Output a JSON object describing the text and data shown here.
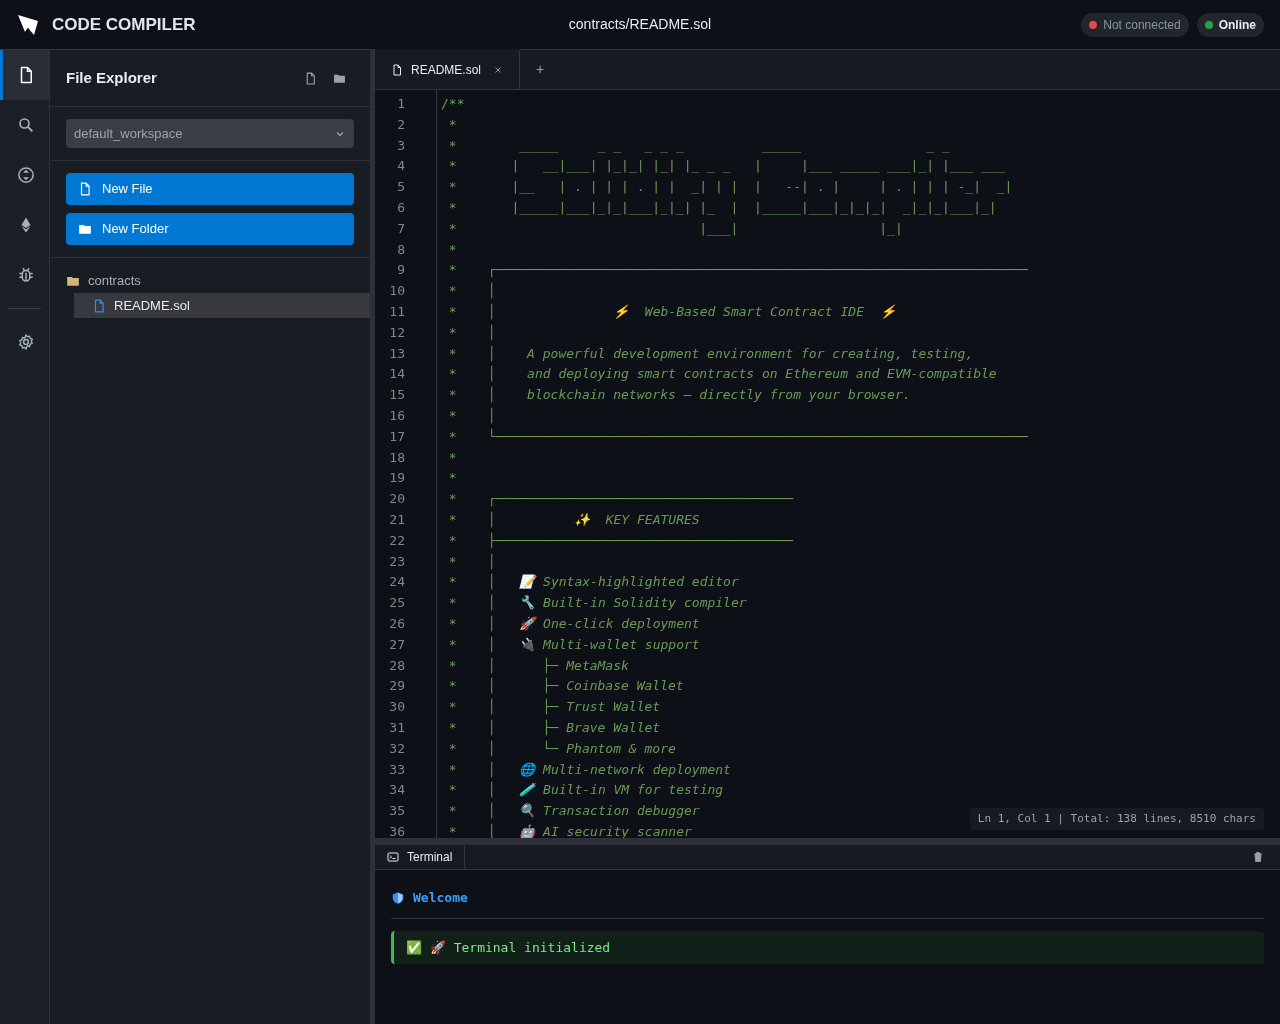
{
  "header": {
    "app_name": "CODE COMPILER",
    "file_path": "contracts/README.sol",
    "badges": [
      {
        "label": "Not connected",
        "color": "#e5484d"
      },
      {
        "label": "Online",
        "color": "#2ea043"
      }
    ]
  },
  "activity_bar": {
    "items": [
      {
        "kind": "files",
        "selected": true
      },
      {
        "kind": "search",
        "selected": false
      },
      {
        "kind": "compile",
        "selected": false
      },
      {
        "kind": "deploy",
        "selected": false
      },
      {
        "kind": "debug",
        "selected": false
      },
      {
        "kind": "settings",
        "selected": false
      }
    ]
  },
  "explorer": {
    "title": "File Explorer",
    "workspace": "default_workspace",
    "buttons": [
      {
        "label": "New File",
        "kind": "file"
      },
      {
        "label": "New Folder",
        "kind": "folder"
      }
    ],
    "tree": [
      {
        "label": "contracts",
        "kind": "folder",
        "selected": false,
        "children": [
          {
            "label": "README.sol",
            "kind": "file",
            "selected": true
          }
        ]
      }
    ]
  },
  "tabs": [
    {
      "label": "README.sol",
      "selected": true
    }
  ],
  "new_tab": "+",
  "editor": {
    "lines": [
      {
        "n": "1",
        "kind": "art",
        "text": "/**"
      },
      {
        "n": "2",
        "kind": "art",
        "text": " *"
      },
      {
        "n": "3",
        "kind": "art",
        "text": " *        _____     _ _   _ _ _          _____                _ _"
      },
      {
        "n": "4",
        "kind": "art",
        "text": " *       |   __|___| |_|_| |_| |_ _ _   |     |___ _____ ___|_| |___ ___"
      },
      {
        "n": "5",
        "kind": "art",
        "text": " *       |__   | . | | | . | |  _| | |  |   --| . |     | . | | | -_|  _|"
      },
      {
        "n": "6",
        "kind": "art",
        "text": " *       |_____|___|_|_|___|_|_| |_  |  |_____|___|_|_|_|  _|_|_|___|_|"
      },
      {
        "n": "7",
        "kind": "art",
        "text": " *                               |___|                  |_|"
      },
      {
        "n": "8",
        "kind": "art",
        "text": " *"
      },
      {
        "n": "9",
        "kind": "art",
        "text": " *    ┌────────────────────────────────────────────────────────────────────"
      },
      {
        "n": "10",
        "kind": "art",
        "text": " *    │"
      },
      {
        "n": "11",
        "kind": "prose",
        "text": " *    │               ⚡  Web-Based Smart Contract IDE  ⚡"
      },
      {
        "n": "12",
        "kind": "art",
        "text": " *    │"
      },
      {
        "n": "13",
        "kind": "prose",
        "text": " *    │    A powerful development environment for creating, testing,"
      },
      {
        "n": "14",
        "kind": "prose",
        "text": " *    │    and deploying smart contracts on Ethereum and EVM-compatible"
      },
      {
        "n": "15",
        "kind": "prose",
        "text": " *    │    blockchain networks — directly from your browser."
      },
      {
        "n": "16",
        "kind": "art",
        "text": " *    │"
      },
      {
        "n": "17",
        "kind": "art",
        "text": " *    └────────────────────────────────────────────────────────────────────"
      },
      {
        "n": "18",
        "kind": "art",
        "text": " *"
      },
      {
        "n": "19",
        "kind": "art",
        "text": " *"
      },
      {
        "n": "20",
        "kind": "art",
        "text": " *    ┌──────────────────────────────────────"
      },
      {
        "n": "21",
        "kind": "prose",
        "text": " *    │          ✨  KEY FEATURES"
      },
      {
        "n": "22",
        "kind": "art",
        "text": " *    ├──────────────────────────────────────"
      },
      {
        "n": "23",
        "kind": "art",
        "text": " *    │"
      },
      {
        "n": "24",
        "kind": "prose",
        "text": " *    │   📝 Syntax-highlighted editor"
      },
      {
        "n": "25",
        "kind": "prose",
        "text": " *    │   🔧 Built-in Solidity compiler"
      },
      {
        "n": "26",
        "kind": "prose",
        "text": " *    │   🚀 One-click deployment"
      },
      {
        "n": "27",
        "kind": "prose",
        "text": " *    │   🔌 Multi-wallet support"
      },
      {
        "n": "28",
        "kind": "prose",
        "text": " *    │      ├─ MetaMask"
      },
      {
        "n": "29",
        "kind": "prose",
        "text": " *    │      ├─ Coinbase Wallet"
      },
      {
        "n": "30",
        "kind": "prose",
        "text": " *    │      ├─ Trust Wallet"
      },
      {
        "n": "31",
        "kind": "prose",
        "text": " *    │      ├─ Brave Wallet"
      },
      {
        "n": "32",
        "kind": "prose",
        "text": " *    │      └─ Phantom & more"
      },
      {
        "n": "33",
        "kind": "prose",
        "text": " *    │   🌐 Multi-network deployment"
      },
      {
        "n": "34",
        "kind": "prose",
        "text": " *    │   🧪 Built-in VM for testing"
      },
      {
        "n": "35",
        "kind": "prose",
        "text": " *    │   🔍 Transaction debugger"
      },
      {
        "n": "36",
        "kind": "prose",
        "text": " *    │   🤖 AI security scanner"
      }
    ],
    "status": "Ln 1, Col 1 | Total: 138 lines, 8510 chars"
  },
  "terminal": {
    "tab": "Terminal",
    "heading": "Welcome",
    "messages": [
      {
        "kind": "success",
        "text": "✅ 🚀 Terminal initialized"
      }
    ]
  }
}
